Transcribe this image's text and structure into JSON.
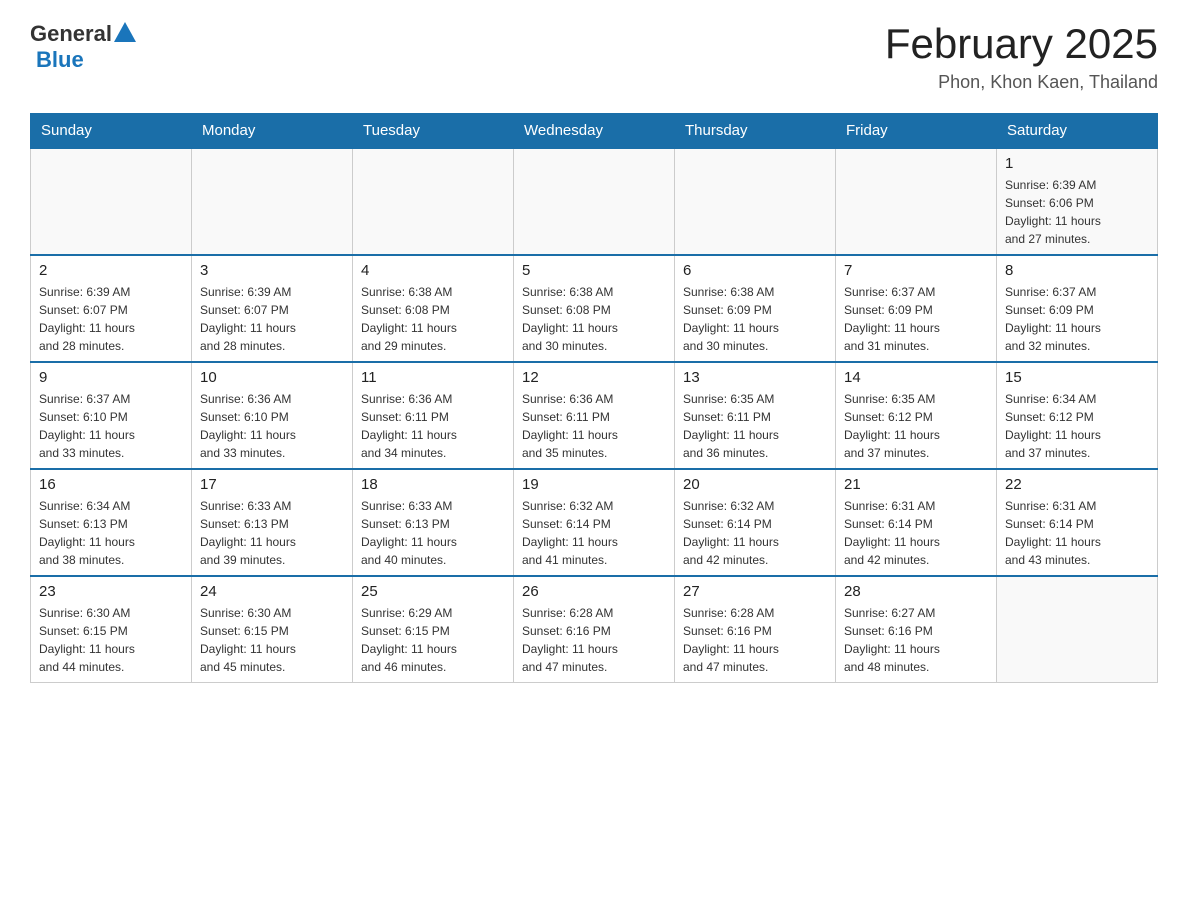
{
  "header": {
    "logo": {
      "general": "General",
      "blue": "Blue"
    },
    "title": "February 2025",
    "location": "Phon, Khon Kaen, Thailand"
  },
  "days_of_week": [
    "Sunday",
    "Monday",
    "Tuesday",
    "Wednesday",
    "Thursday",
    "Friday",
    "Saturday"
  ],
  "weeks": [
    {
      "days": [
        {
          "num": "",
          "info": ""
        },
        {
          "num": "",
          "info": ""
        },
        {
          "num": "",
          "info": ""
        },
        {
          "num": "",
          "info": ""
        },
        {
          "num": "",
          "info": ""
        },
        {
          "num": "",
          "info": ""
        },
        {
          "num": "1",
          "info": "Sunrise: 6:39 AM\nSunset: 6:06 PM\nDaylight: 11 hours\nand 27 minutes."
        }
      ]
    },
    {
      "days": [
        {
          "num": "2",
          "info": "Sunrise: 6:39 AM\nSunset: 6:07 PM\nDaylight: 11 hours\nand 28 minutes."
        },
        {
          "num": "3",
          "info": "Sunrise: 6:39 AM\nSunset: 6:07 PM\nDaylight: 11 hours\nand 28 minutes."
        },
        {
          "num": "4",
          "info": "Sunrise: 6:38 AM\nSunset: 6:08 PM\nDaylight: 11 hours\nand 29 minutes."
        },
        {
          "num": "5",
          "info": "Sunrise: 6:38 AM\nSunset: 6:08 PM\nDaylight: 11 hours\nand 30 minutes."
        },
        {
          "num": "6",
          "info": "Sunrise: 6:38 AM\nSunset: 6:09 PM\nDaylight: 11 hours\nand 30 minutes."
        },
        {
          "num": "7",
          "info": "Sunrise: 6:37 AM\nSunset: 6:09 PM\nDaylight: 11 hours\nand 31 minutes."
        },
        {
          "num": "8",
          "info": "Sunrise: 6:37 AM\nSunset: 6:09 PM\nDaylight: 11 hours\nand 32 minutes."
        }
      ]
    },
    {
      "days": [
        {
          "num": "9",
          "info": "Sunrise: 6:37 AM\nSunset: 6:10 PM\nDaylight: 11 hours\nand 33 minutes."
        },
        {
          "num": "10",
          "info": "Sunrise: 6:36 AM\nSunset: 6:10 PM\nDaylight: 11 hours\nand 33 minutes."
        },
        {
          "num": "11",
          "info": "Sunrise: 6:36 AM\nSunset: 6:11 PM\nDaylight: 11 hours\nand 34 minutes."
        },
        {
          "num": "12",
          "info": "Sunrise: 6:36 AM\nSunset: 6:11 PM\nDaylight: 11 hours\nand 35 minutes."
        },
        {
          "num": "13",
          "info": "Sunrise: 6:35 AM\nSunset: 6:11 PM\nDaylight: 11 hours\nand 36 minutes."
        },
        {
          "num": "14",
          "info": "Sunrise: 6:35 AM\nSunset: 6:12 PM\nDaylight: 11 hours\nand 37 minutes."
        },
        {
          "num": "15",
          "info": "Sunrise: 6:34 AM\nSunset: 6:12 PM\nDaylight: 11 hours\nand 37 minutes."
        }
      ]
    },
    {
      "days": [
        {
          "num": "16",
          "info": "Sunrise: 6:34 AM\nSunset: 6:13 PM\nDaylight: 11 hours\nand 38 minutes."
        },
        {
          "num": "17",
          "info": "Sunrise: 6:33 AM\nSunset: 6:13 PM\nDaylight: 11 hours\nand 39 minutes."
        },
        {
          "num": "18",
          "info": "Sunrise: 6:33 AM\nSunset: 6:13 PM\nDaylight: 11 hours\nand 40 minutes."
        },
        {
          "num": "19",
          "info": "Sunrise: 6:32 AM\nSunset: 6:14 PM\nDaylight: 11 hours\nand 41 minutes."
        },
        {
          "num": "20",
          "info": "Sunrise: 6:32 AM\nSunset: 6:14 PM\nDaylight: 11 hours\nand 42 minutes."
        },
        {
          "num": "21",
          "info": "Sunrise: 6:31 AM\nSunset: 6:14 PM\nDaylight: 11 hours\nand 42 minutes."
        },
        {
          "num": "22",
          "info": "Sunrise: 6:31 AM\nSunset: 6:14 PM\nDaylight: 11 hours\nand 43 minutes."
        }
      ]
    },
    {
      "days": [
        {
          "num": "23",
          "info": "Sunrise: 6:30 AM\nSunset: 6:15 PM\nDaylight: 11 hours\nand 44 minutes."
        },
        {
          "num": "24",
          "info": "Sunrise: 6:30 AM\nSunset: 6:15 PM\nDaylight: 11 hours\nand 45 minutes."
        },
        {
          "num": "25",
          "info": "Sunrise: 6:29 AM\nSunset: 6:15 PM\nDaylight: 11 hours\nand 46 minutes."
        },
        {
          "num": "26",
          "info": "Sunrise: 6:28 AM\nSunset: 6:16 PM\nDaylight: 11 hours\nand 47 minutes."
        },
        {
          "num": "27",
          "info": "Sunrise: 6:28 AM\nSunset: 6:16 PM\nDaylight: 11 hours\nand 47 minutes."
        },
        {
          "num": "28",
          "info": "Sunrise: 6:27 AM\nSunset: 6:16 PM\nDaylight: 11 hours\nand 48 minutes."
        },
        {
          "num": "",
          "info": ""
        }
      ]
    }
  ]
}
